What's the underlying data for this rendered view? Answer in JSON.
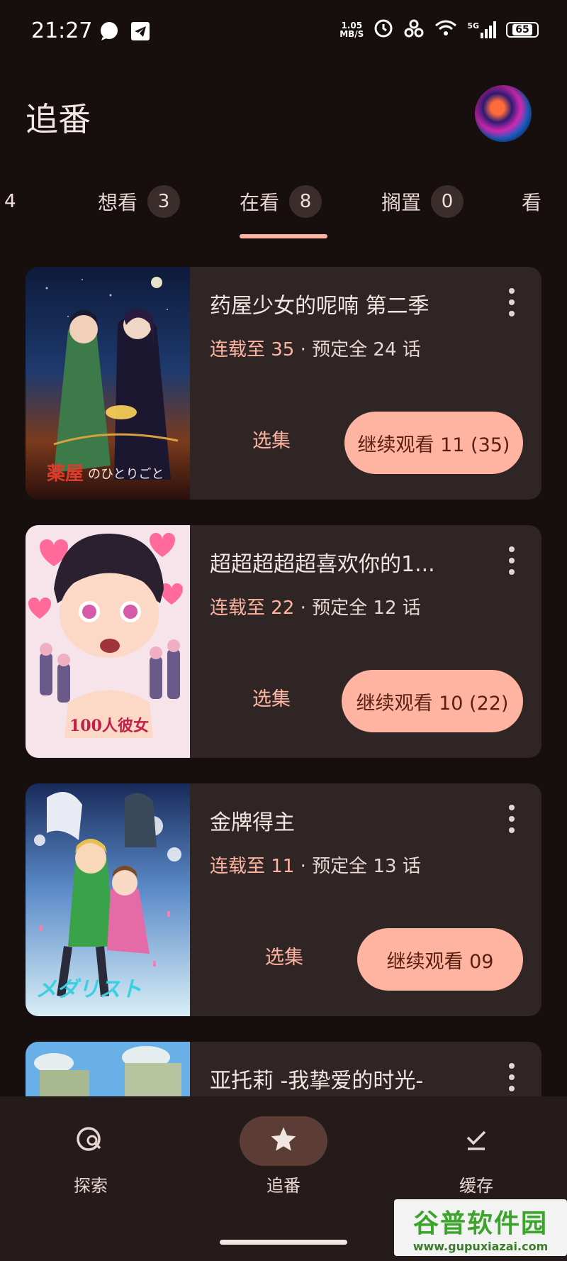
{
  "status_bar": {
    "time": "21:27",
    "left_icons": [
      "message-icon",
      "telegram-icon"
    ],
    "speed_value": "1.05",
    "speed_unit": "MB/S",
    "network": "5G",
    "battery": "65"
  },
  "header": {
    "title": "追番"
  },
  "tabs": [
    {
      "label": "",
      "count": "4"
    },
    {
      "label": "想看",
      "count": "3"
    },
    {
      "label": "在看",
      "count": "8",
      "active": true
    },
    {
      "label": "搁置",
      "count": "0"
    },
    {
      "label": "看",
      "count": ""
    }
  ],
  "cards": [
    {
      "title": "药屋少女的呢喃 第二季",
      "progress_prefix": "连载至 35",
      "progress_suffix": " · 预定全 24 话",
      "episodes_label": "选集",
      "continue_label": "继续观看 11 (35)"
    },
    {
      "title": "超超超超超喜欢你的1...",
      "progress_prefix": "连载至 22",
      "progress_suffix": " · 预定全 12 话",
      "episodes_label": "选集",
      "continue_label": "继续观看 10 (22)"
    },
    {
      "title": "金牌得主",
      "progress_prefix": "连载至 11",
      "progress_suffix": " · 预定全 13 话",
      "episodes_label": "选集",
      "continue_label": "继续观看 09"
    },
    {
      "title": "亚托莉 -我挚爱的时光-"
    }
  ],
  "bottom_nav": [
    {
      "label": "探索",
      "icon": "explore-search-icon"
    },
    {
      "label": "追番",
      "icon": "star-icon",
      "active": true
    },
    {
      "label": "缓存",
      "icon": "download-done-icon"
    }
  ],
  "watermark": {
    "title": "谷普软件园",
    "url": "www.gupuxiazai.com"
  },
  "colors": {
    "background": "#160f0e",
    "card": "#2e2524",
    "accent": "#ffb4a1",
    "nav_active": "#5b3d36"
  }
}
